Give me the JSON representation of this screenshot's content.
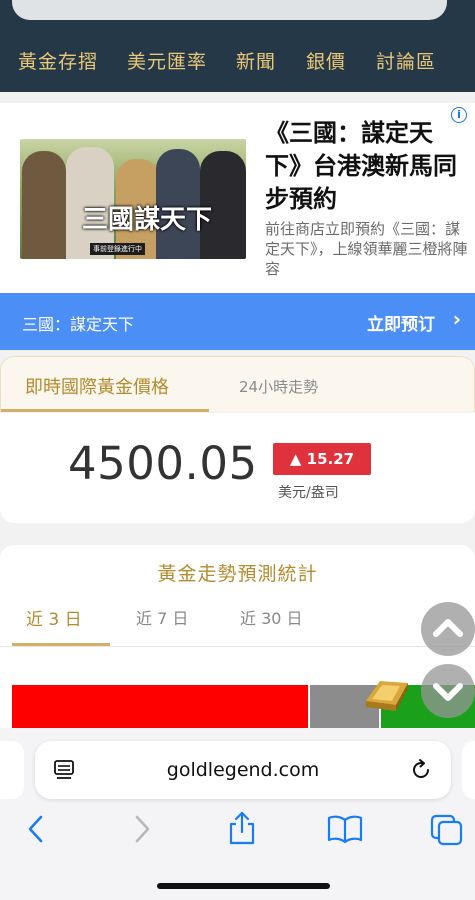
{
  "nav": {
    "items": [
      "黃金存摺",
      "美元匯率",
      "新聞",
      "銀價",
      "討論區"
    ]
  },
  "ad": {
    "image_logo": "三國謀天下",
    "image_sub": "事前登錄進行中",
    "title": "《三國：謀定天下》台港澳新馬同步預約",
    "description": "前往商店立即預約《三國：謀定天下》，上線領華麗三橙將陣容",
    "cta_left": "三國：謀定天下",
    "cta_right": "立即预订"
  },
  "gold": {
    "tab_active": "即時國際黃金價格",
    "tab_inactive": "24小時走勢",
    "price": "4500.05",
    "change": "▲ 15.27",
    "unit": "美元/盎司"
  },
  "forecast": {
    "title": "黃金走勢預測統計",
    "tabs": [
      "近 3 日",
      "近 7 日",
      "近 30 日"
    ],
    "active_tab": 0,
    "bar_colors": {
      "down": "#ff0000",
      "neutral": "#8c8c8c",
      "up": "#1aa01a"
    },
    "bar_fractions": {
      "down": 0.64,
      "neutral": 0.15,
      "up": 0.21
    }
  },
  "browser": {
    "url": "goldlegend.com"
  },
  "colors": {
    "header_bg": "#243847",
    "gold_text": "#e8c776",
    "accent_gold": "#b48b2f",
    "cta_blue": "#4b8ef6",
    "price_up_red": "#e0323c",
    "ios_blue": "#1a7cf5"
  }
}
